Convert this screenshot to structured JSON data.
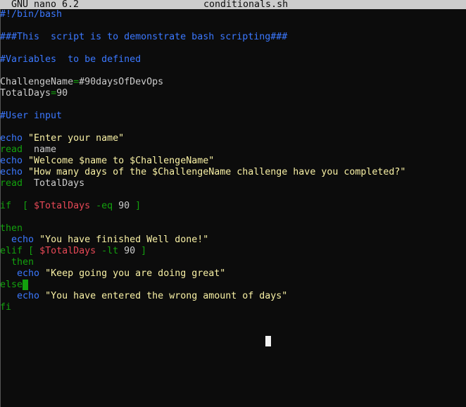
{
  "titlebar": {
    "app": "GNU nano 6.2",
    "filename": "conditionals.sh"
  },
  "lines": [
    [
      {
        "t": "#!/bin/bash",
        "c": "comment"
      }
    ],
    [],
    [
      {
        "t": "###This  script is to demonstrate bash scripting###",
        "c": "comment"
      }
    ],
    [],
    [
      {
        "t": "#Variables  to be defined",
        "c": "comment"
      }
    ],
    [],
    [
      {
        "t": "ChallengeName",
        "c": "plain"
      },
      {
        "t": "=",
        "c": "op"
      },
      {
        "t": "#90daysOfDevOps",
        "c": "plain"
      }
    ],
    [
      {
        "t": "TotalDays",
        "c": "plain"
      },
      {
        "t": "=",
        "c": "op"
      },
      {
        "t": "90",
        "c": "plain"
      }
    ],
    [],
    [
      {
        "t": "#User input",
        "c": "comment"
      }
    ],
    [],
    [
      {
        "t": "echo",
        "c": "builtin"
      },
      {
        "t": " ",
        "c": "plain"
      },
      {
        "t": "\"Enter your name\"",
        "c": "string"
      }
    ],
    [
      {
        "t": "read",
        "c": "kw"
      },
      {
        "t": "  name",
        "c": "plain"
      }
    ],
    [
      {
        "t": "echo",
        "c": "builtin"
      },
      {
        "t": " ",
        "c": "plain"
      },
      {
        "t": "\"Welcome $name to $ChallengeName\"",
        "c": "string"
      }
    ],
    [
      {
        "t": "echo",
        "c": "builtin"
      },
      {
        "t": " ",
        "c": "plain"
      },
      {
        "t": "\"How many days of the $ChallengeName challenge have you completed?\"",
        "c": "string"
      }
    ],
    [
      {
        "t": "read",
        "c": "kw"
      },
      {
        "t": "  TotalDays",
        "c": "plain"
      }
    ],
    [],
    [
      {
        "t": "if",
        "c": "kw"
      },
      {
        "t": "  [ ",
        "c": "op"
      },
      {
        "t": "$TotalDays",
        "c": "var"
      },
      {
        "t": " -eq ",
        "c": "op"
      },
      {
        "t": "90",
        "c": "plain"
      },
      {
        "t": " ]",
        "c": "op"
      }
    ],
    [],
    [
      {
        "t": "then",
        "c": "kw"
      }
    ],
    [
      {
        "t": "  ",
        "c": "plain"
      },
      {
        "t": "echo",
        "c": "builtin"
      },
      {
        "t": " ",
        "c": "plain"
      },
      {
        "t": "\"You have finished Well done!\"",
        "c": "string"
      }
    ],
    [
      {
        "t": "elif",
        "c": "kw"
      },
      {
        "t": " [ ",
        "c": "op"
      },
      {
        "t": "$TotalDays",
        "c": "var"
      },
      {
        "t": " -lt ",
        "c": "op"
      },
      {
        "t": "90",
        "c": "plain"
      },
      {
        "t": " ]",
        "c": "op"
      }
    ],
    [
      {
        "t": "  then",
        "c": "kw"
      }
    ],
    [
      {
        "t": "   ",
        "c": "plain"
      },
      {
        "t": "echo",
        "c": "builtin"
      },
      {
        "t": " ",
        "c": "plain"
      },
      {
        "t": "\"Keep going you are doing great\"",
        "c": "string"
      }
    ],
    [
      {
        "t": "else",
        "c": "kw"
      },
      {
        "t": "",
        "c": "cursor"
      }
    ],
    [
      {
        "t": "   ",
        "c": "plain"
      },
      {
        "t": "echo",
        "c": "builtin"
      },
      {
        "t": " ",
        "c": "plain"
      },
      {
        "t": "\"You have entered the wrong amount of days\"",
        "c": "string"
      }
    ],
    [
      {
        "t": "fi",
        "c": "kw"
      }
    ]
  ]
}
